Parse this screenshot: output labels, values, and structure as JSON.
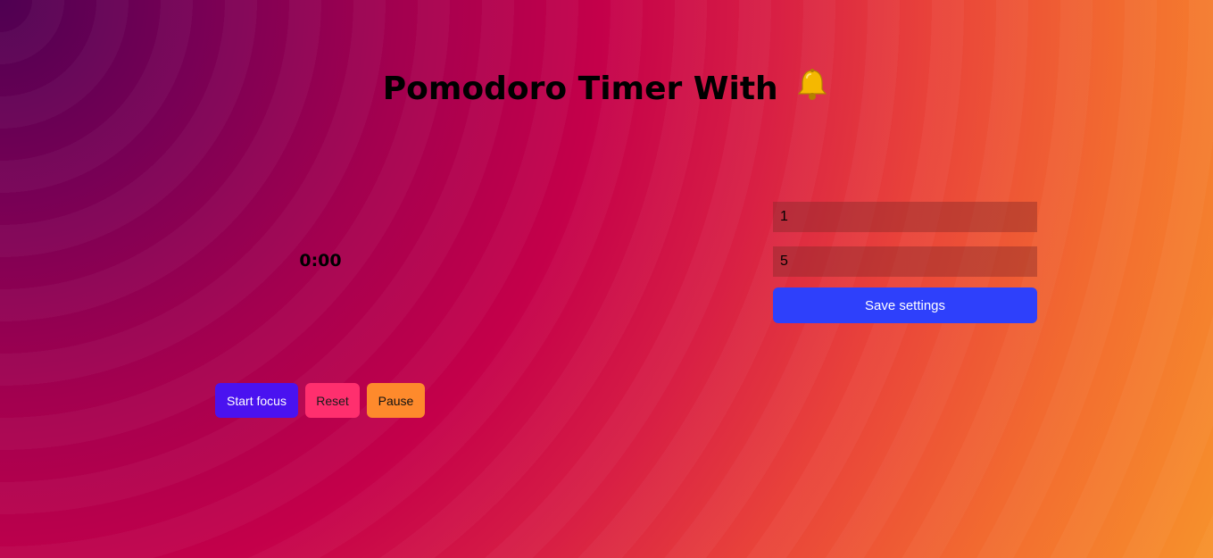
{
  "header": {
    "title": "Pomodoro Timer With",
    "title_icon": "bell-icon"
  },
  "timer": {
    "display": "0:00"
  },
  "controls": {
    "start_label": "Start focus",
    "reset_label": "Reset",
    "pause_label": "Pause"
  },
  "settings": {
    "focus_value": "1",
    "break_value": "5",
    "save_label": "Save settings"
  },
  "colors": {
    "start_button": "#4a12f0",
    "reset_button": "#ff2f6e",
    "pause_button": "#fe8a2c",
    "save_button": "#2e40fb"
  }
}
